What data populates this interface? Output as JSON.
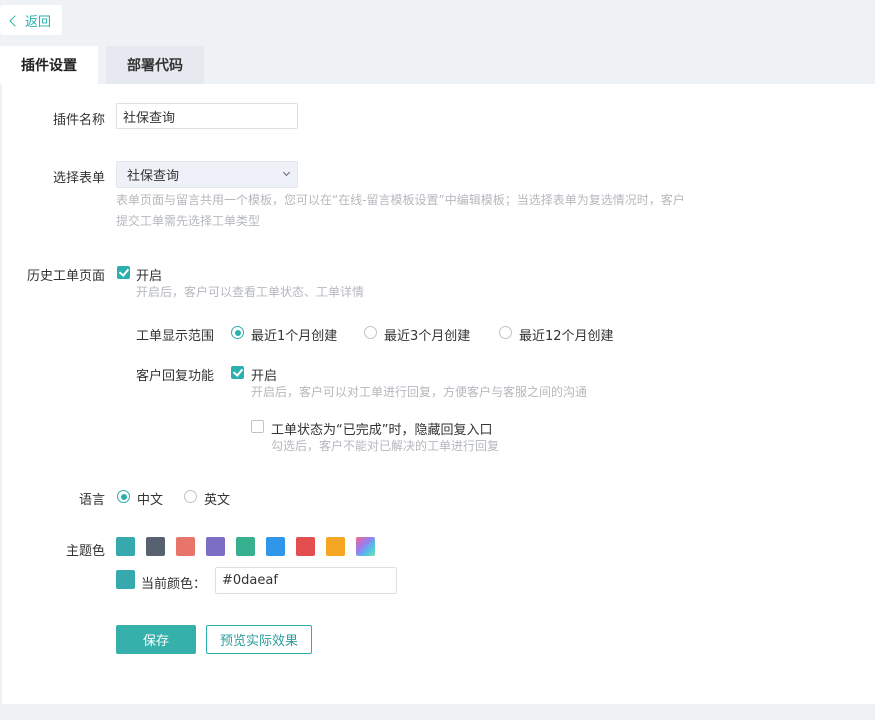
{
  "back": {
    "label": "返回"
  },
  "tabs": [
    {
      "label": "插件设置",
      "active": true
    },
    {
      "label": "部署代码",
      "active": false
    }
  ],
  "form": {
    "plugin_name": {
      "label": "插件名称",
      "value": "社保查询"
    },
    "select_form": {
      "label": "选择表单",
      "value": "社保查询",
      "hint_line1": "表单页面与留言共用一个模板，您可以在“在线-留言模板设置”中编辑模板；当选择表单为复选情况时，客户",
      "hint_line2": "提交工单需先选择工单类型"
    },
    "history_page": {
      "label": "历史工单页面",
      "checked": true,
      "option": "开启",
      "hint": "开启后，客户可以查看工单状态、工单详情",
      "display_range": {
        "label": "工单显示范围",
        "options": [
          "最近1个月创建",
          "最近3个月创建",
          "最近12个月创建"
        ],
        "selected": "最近1个月创建"
      },
      "reply": {
        "label": "客户回复功能",
        "checked": true,
        "option": "开启",
        "hint": "开启后，客户可以对工单进行回复，方便客户与客服之间的沟通",
        "hide_entry": {
          "checked": false,
          "label": "工单状态为“已完成”时，隐藏回复入口",
          "hint": "勾选后，客户不能对已解决的工单进行回复"
        }
      }
    },
    "language": {
      "label": "语言",
      "options": [
        "中文",
        "英文"
      ],
      "selected": "中文"
    },
    "theme": {
      "label": "主题色",
      "swatches": [
        "#35a9ae",
        "#586170",
        "#e8756a",
        "#7c6ec4",
        "#36b08e",
        "#2f96ea",
        "#e54e4e",
        "#f5a623",
        "gradient"
      ],
      "current_label": "当前颜色：",
      "current_value": "#0daeaf",
      "current_color": "#35a9ae"
    }
  },
  "actions": {
    "save": "保存",
    "preview": "预览实际效果"
  }
}
